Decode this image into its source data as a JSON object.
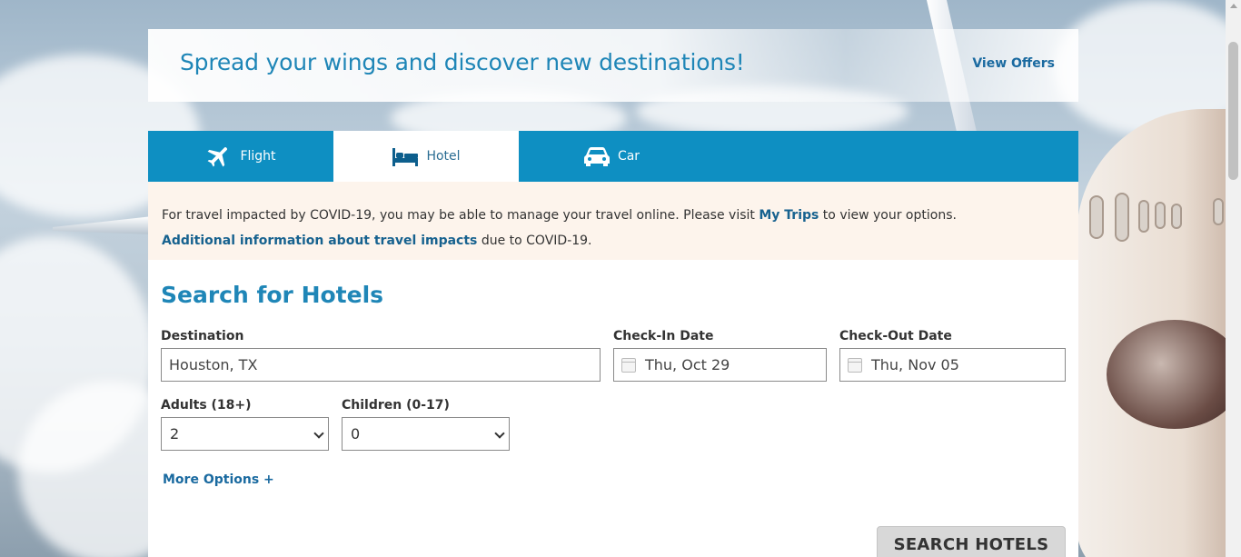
{
  "promo": {
    "title": "Spread your wings and discover new destinations!",
    "link": "View Offers"
  },
  "tabs": [
    {
      "label": "Flight",
      "icon": "plane-icon",
      "active": false
    },
    {
      "label": "Hotel",
      "icon": "bed-icon",
      "active": true
    },
    {
      "label": "Car",
      "icon": "car-icon",
      "active": false
    }
  ],
  "notice": {
    "line1_before": "For travel impacted by COVID-19, you may be able to manage your travel online. Please visit ",
    "line1_link": "My Trips",
    "line1_after": " to view your options.",
    "line2_link": "Additional information about travel impacts",
    "line2_after": " due to COVID-19."
  },
  "form": {
    "title": "Search for Hotels",
    "destination_label": "Destination",
    "destination_value": "Houston, TX",
    "checkin_label": "Check-In Date",
    "checkin_value": "Thu, Oct 29",
    "checkout_label": "Check-Out Date",
    "checkout_value": "Thu, Nov 05",
    "adults_label": "Adults (18+)",
    "adults_value": "2",
    "children_label": "Children (0-17)",
    "children_value": "0",
    "more_options": "More Options +",
    "search_button": "SEARCH HOTELS"
  },
  "colors": {
    "tab_bar": "#0e8fc2",
    "title_blue": "#1f86b7",
    "link_blue": "#1a6aa0",
    "notice_bg": "#fdf4ec"
  }
}
